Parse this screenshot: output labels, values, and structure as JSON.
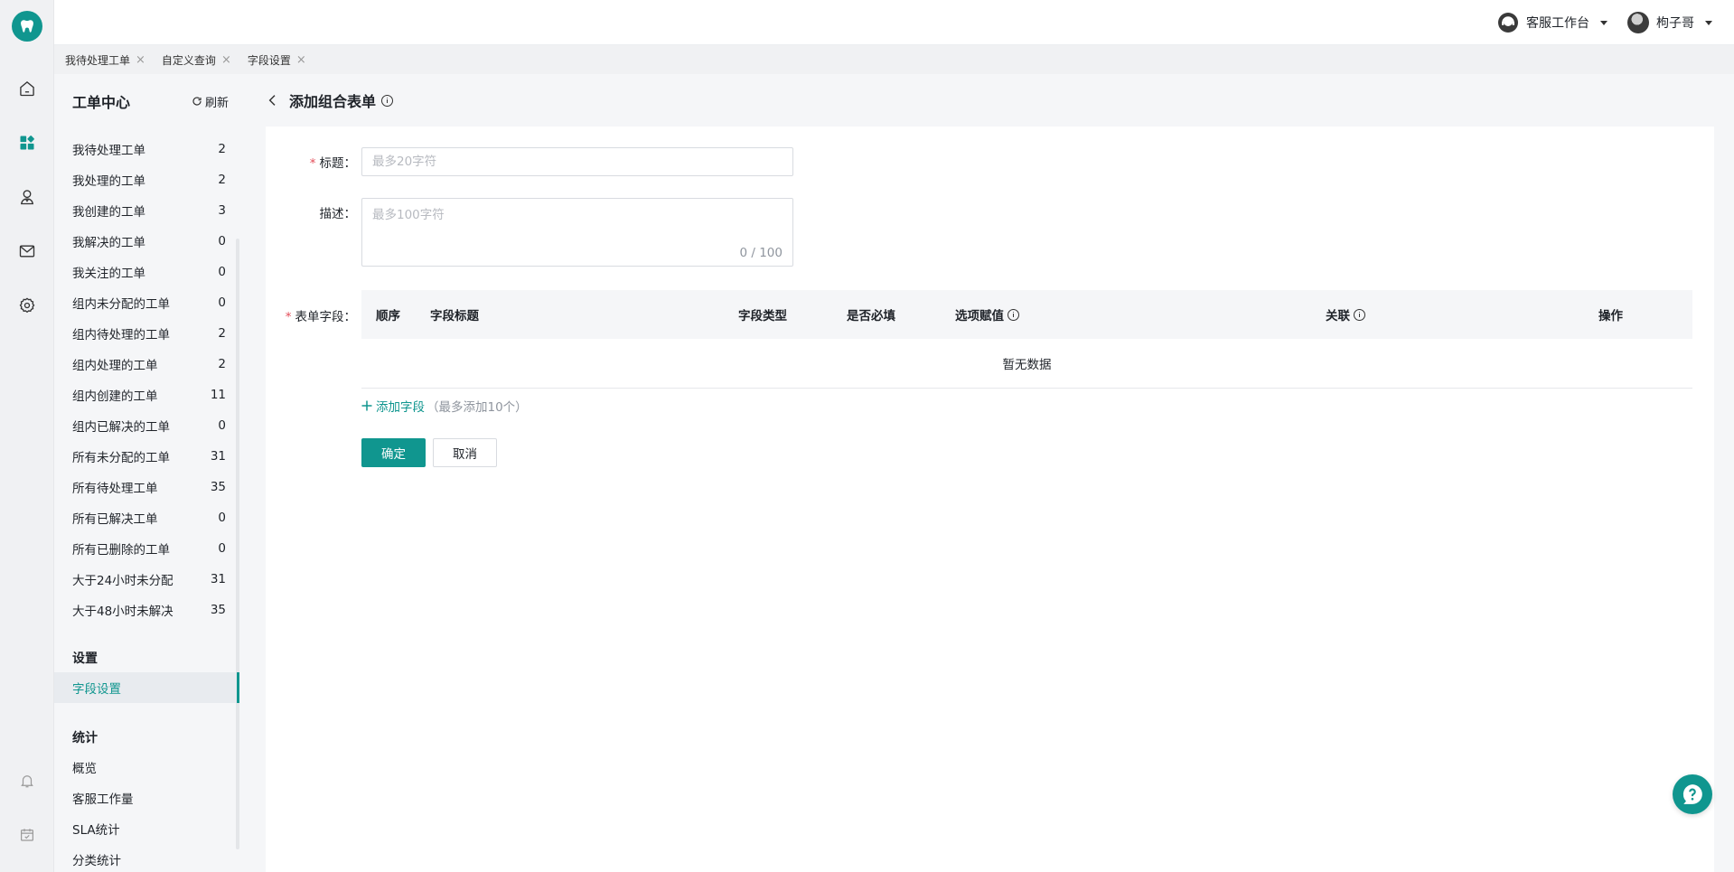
{
  "colors": {
    "accent": "#10968f",
    "required": "#e34d59"
  },
  "rail": {
    "logo_icon": "tooth-logo-icon",
    "items": [
      "home-icon",
      "dashboard-icon",
      "agents-icon",
      "mail-icon",
      "settings-icon"
    ],
    "bottom_items": [
      "bell-icon",
      "calendar-icon"
    ]
  },
  "topbar": {
    "workspace_label": "客服工作台",
    "user_name": "枸子哥"
  },
  "tabs": [
    {
      "label": "我待处理工单"
    },
    {
      "label": "自定义查询"
    },
    {
      "label": "字段设置"
    }
  ],
  "sidebar": {
    "title": "工单中心",
    "refresh_label": "刷新",
    "items": [
      {
        "label": "我待处理工单",
        "count": "2"
      },
      {
        "label": "我处理的工单",
        "count": "2"
      },
      {
        "label": "我创建的工单",
        "count": "3"
      },
      {
        "label": "我解决的工单",
        "count": "0"
      },
      {
        "label": "我关注的工单",
        "count": "0"
      },
      {
        "label": "组内未分配的工单",
        "count": "0"
      },
      {
        "label": "组内待处理的工单",
        "count": "2"
      },
      {
        "label": "组内处理的工单",
        "count": "2"
      },
      {
        "label": "组内创建的工单",
        "count": "11"
      },
      {
        "label": "组内已解决的工单",
        "count": "0"
      },
      {
        "label": "所有未分配的工单",
        "count": "31"
      },
      {
        "label": "所有待处理工单",
        "count": "35"
      },
      {
        "label": "所有已解决工单",
        "count": "0"
      },
      {
        "label": "所有已删除的工单",
        "count": "0"
      },
      {
        "label": "大于24小时未分配",
        "count": "31"
      },
      {
        "label": "大于48小时未解决",
        "count": "35"
      }
    ],
    "settings_title": "设置",
    "settings_items": [
      {
        "label": "字段设置",
        "active": true
      }
    ],
    "stats_title": "统计",
    "stats_items": [
      {
        "label": "概览"
      },
      {
        "label": "客服工作量"
      },
      {
        "label": "SLA统计"
      },
      {
        "label": "分类统计"
      }
    ]
  },
  "page": {
    "title": "添加组合表单",
    "form": {
      "title_label": "标题",
      "title_placeholder": "最多20字符",
      "title_value": "",
      "desc_label": "描述",
      "desc_placeholder": "最多100字符",
      "desc_count": "0 / 100",
      "fields_label": "表单字段",
      "columns": [
        "顺序",
        "字段标题",
        "字段类型",
        "是否必填",
        "选项赋值",
        "关联",
        "操作"
      ],
      "empty_text": "暂无数据",
      "add_field_label": "添加字段",
      "add_field_hint": "（最多添加10个）",
      "confirm_label": "确定",
      "cancel_label": "取消"
    }
  }
}
